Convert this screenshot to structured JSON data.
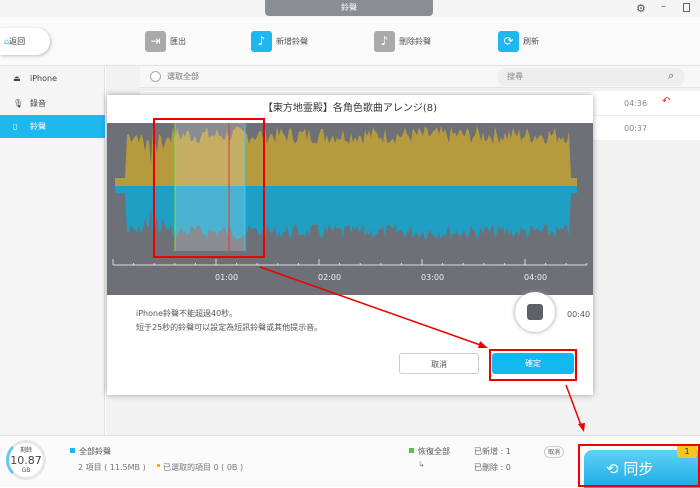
{
  "window": {
    "title": "鈴聲"
  },
  "toolbar": {
    "back": "返回",
    "export": "匯出",
    "add": "新增鈴聲",
    "delete": "刪除鈴聲",
    "refresh": "刷新"
  },
  "sidebar": {
    "device": "iPhone",
    "items": [
      {
        "label": "錄音",
        "icon": "microphone-icon"
      },
      {
        "label": "鈴聲",
        "icon": "phone-icon",
        "active": true
      }
    ]
  },
  "list": {
    "select_all": "選取全部",
    "search_placeholder": "搜尋",
    "rows": [
      {
        "duration": "04:36"
      },
      {
        "duration": "00:37"
      }
    ]
  },
  "dialog": {
    "title": "【東方地霊殿】各角色歌曲アレンジ(8)",
    "ticks": [
      "01:00",
      "02:00",
      "03:00",
      "04:00"
    ],
    "note1": "iPhone鈴聲不能超過40秒。",
    "note2": "短于25秒的鈴聲可以設定為短訊鈴聲或其他提示音。",
    "duration": "00:40",
    "cancel": "取消",
    "ok": "確定"
  },
  "footer": {
    "storage_label": "剩餘",
    "storage_value": "10.87",
    "storage_unit": "GB",
    "all_label": "全部鈴聲",
    "items_info": "2 項目 ( 11.5MB )",
    "selected_info": "已選取的項目 0 ( 0B )",
    "restore": "恢復全部",
    "added": "已新增 : 1",
    "deleted": "已刪除 : 0",
    "cancel": "取消",
    "sync": "同步",
    "badge": "1"
  },
  "colors": {
    "accent": "#1cb8ee",
    "gold": "#b59a3e",
    "highlight_gold": "#f7d24c",
    "wave_blue": "#1f9fc3",
    "annotation": "#e00000"
  }
}
